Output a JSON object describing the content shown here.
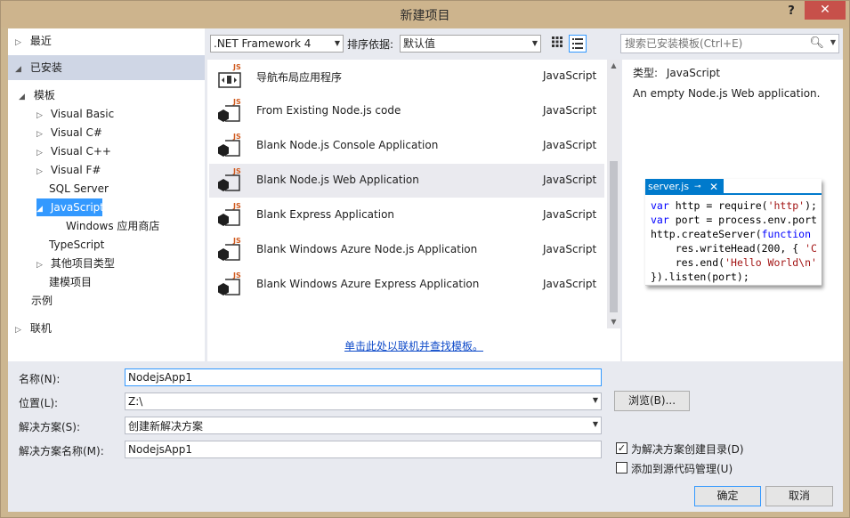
{
  "window": {
    "title": "新建项目",
    "help": "?",
    "close": "✕"
  },
  "tree": {
    "recent": "最近",
    "installed": "已安装",
    "templates": "模板",
    "items": [
      {
        "label": "Visual Basic"
      },
      {
        "label": "Visual C#"
      },
      {
        "label": "Visual C++"
      },
      {
        "label": "Visual F#"
      },
      {
        "label": "SQL Server"
      },
      {
        "label": "JavaScript"
      },
      {
        "label": "Windows 应用商店"
      },
      {
        "label": "TypeScript"
      },
      {
        "label": "其他项目类型"
      },
      {
        "label": "建模项目"
      }
    ],
    "samples": "示例",
    "online": "联机"
  },
  "toolbar": {
    "framework": ".NET Framework 4",
    "sort_label": "排序依据:",
    "sort_value": "默认值"
  },
  "templates": [
    {
      "name": "导航布局应用程序",
      "lang": "JavaScript"
    },
    {
      "name": "From Existing Node.js code",
      "lang": "JavaScript"
    },
    {
      "name": "Blank Node.js Console Application",
      "lang": "JavaScript"
    },
    {
      "name": "Blank Node.js Web Application",
      "lang": "JavaScript"
    },
    {
      "name": "Blank Express Application",
      "lang": "JavaScript"
    },
    {
      "name": "Blank Windows Azure Node.js Application",
      "lang": "JavaScript"
    },
    {
      "name": "Blank Windows Azure Express Application",
      "lang": "JavaScript"
    }
  ],
  "online_link": "单击此处以联机并查找模板。",
  "search": {
    "placeholder": "搜索已安装模板(Ctrl+E)"
  },
  "details": {
    "type_label": "类型:",
    "type_value": "JavaScript",
    "description": "An empty Node.js Web application.",
    "preview_tab": "server.js",
    "code": {
      "l1a": "var",
      "l1b": " http = require(",
      "l1c": "'http'",
      "l1d": ");",
      "l2a": "var",
      "l2b": " port = process.env.port",
      "l3a": "http.createServer(",
      "l3b": "function",
      "l4a": "    res.writeHead(200, { ",
      "l4b": "'C",
      "l5a": "    res.end(",
      "l5b": "'Hello World\\n'",
      "l6": "}).listen(port);"
    }
  },
  "form": {
    "name_label": "名称(N):",
    "name_value": "NodejsApp1",
    "location_label": "位置(L):",
    "location_value": "Z:\\",
    "browse": "浏览(B)...",
    "solution_label": "解决方案(S):",
    "solution_value": "创建新解决方案",
    "solution_name_label": "解决方案名称(M):",
    "solution_name_value": "NodejsApp1",
    "create_dir": "为解决方案创建目录(D)",
    "add_source_control": "添加到源代码管理(U)",
    "ok": "确定",
    "cancel": "取消"
  }
}
